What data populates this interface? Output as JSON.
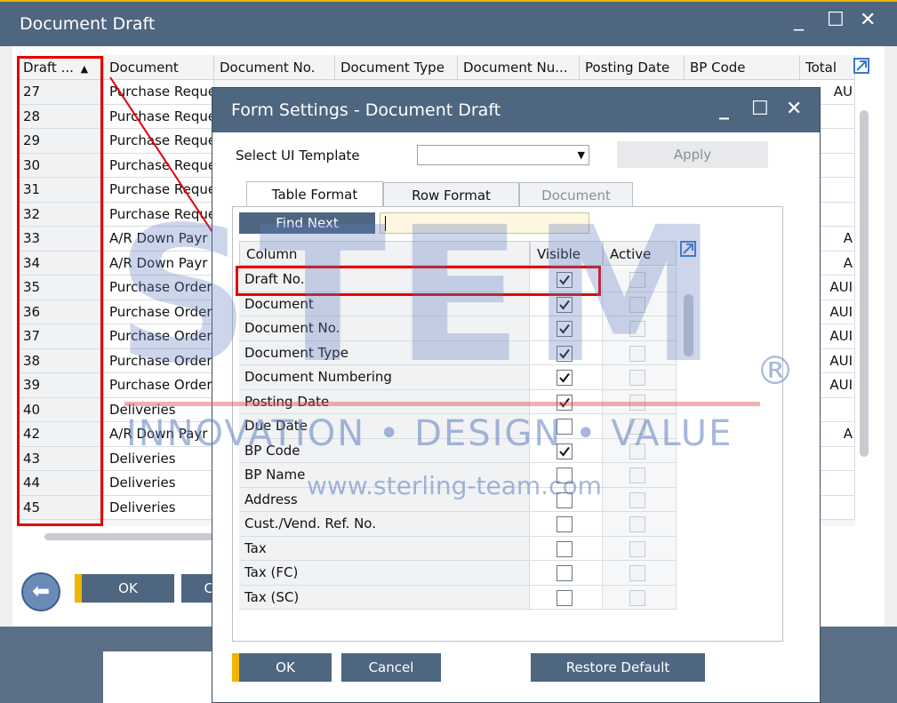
{
  "main_window": {
    "title": "Document Draft",
    "controls": {
      "minimize": "_",
      "maximize": "☐",
      "close": "✕"
    },
    "columns": [
      "Draft ...",
      "Document",
      "Document No.",
      "Document Type",
      "Document Nu...",
      "Posting Date",
      "BP Code",
      "Total"
    ],
    "sort_indicator": "▲",
    "rows": [
      {
        "draft": "27",
        "document": "Purchase Reque",
        "currency": "AU"
      },
      {
        "draft": "28",
        "document": "Purchase Reque",
        "currency": ""
      },
      {
        "draft": "29",
        "document": "Purchase Reque",
        "currency": ""
      },
      {
        "draft": "30",
        "document": "Purchase Reque",
        "currency": ""
      },
      {
        "draft": "31",
        "document": "Purchase Reque",
        "currency": ""
      },
      {
        "draft": "32",
        "document": "Purchase Reque",
        "currency": ""
      },
      {
        "draft": "33",
        "document": "A/R Down Payr",
        "currency": "A"
      },
      {
        "draft": "34",
        "document": "A/R Down Payr",
        "currency": "A"
      },
      {
        "draft": "35",
        "document": "Purchase Order",
        "currency": "AUI"
      },
      {
        "draft": "36",
        "document": "Purchase Order",
        "currency": "AUI"
      },
      {
        "draft": "37",
        "document": "Purchase Order",
        "currency": "AUI"
      },
      {
        "draft": "38",
        "document": "Purchase Order",
        "currency": "AUI"
      },
      {
        "draft": "39",
        "document": "Purchase Order",
        "currency": "AUI"
      },
      {
        "draft": "40",
        "document": "Deliveries",
        "currency": ""
      },
      {
        "draft": "42",
        "document": "A/R Down Payr",
        "currency": "A"
      },
      {
        "draft": "43",
        "document": "Deliveries",
        "currency": ""
      },
      {
        "draft": "44",
        "document": "Deliveries",
        "currency": ""
      },
      {
        "draft": "45",
        "document": "Deliveries",
        "currency": ""
      }
    ],
    "ok_label": "OK",
    "cancel_label_partial": "C"
  },
  "dialog": {
    "title": "Form Settings - Document Draft",
    "controls": {
      "minimize": "_",
      "maximize": "☐",
      "close": "✕"
    },
    "ui_template_label": "Select UI Template",
    "ui_template_value": "",
    "apply_label": "Apply",
    "tabs": [
      {
        "label": "Table Format",
        "state": "active"
      },
      {
        "label": "Row Format",
        "state": "normal"
      },
      {
        "label": "Document",
        "state": "disabled"
      }
    ],
    "find_next_label": "Find Next",
    "find_value": "",
    "headers": {
      "column": "Column",
      "visible": "Visible",
      "active": "Active"
    },
    "rows": [
      {
        "name": "Draft No.",
        "visible": true,
        "active": false
      },
      {
        "name": "Document",
        "visible": true,
        "active": false
      },
      {
        "name": "Document No.",
        "visible": true,
        "active": false
      },
      {
        "name": "Document Type",
        "visible": true,
        "active": false
      },
      {
        "name": "Document Numbering",
        "visible": true,
        "active": false
      },
      {
        "name": "Posting Date",
        "visible": true,
        "active": false
      },
      {
        "name": "Due Date",
        "visible": false,
        "active": false
      },
      {
        "name": "BP Code",
        "visible": true,
        "active": false
      },
      {
        "name": "BP Name",
        "visible": false,
        "active": false
      },
      {
        "name": "Address",
        "visible": false,
        "active": false
      },
      {
        "name": "Cust./Vend. Ref. No.",
        "visible": false,
        "active": false
      },
      {
        "name": "Tax",
        "visible": false,
        "active": false
      },
      {
        "name": "Tax (FC)",
        "visible": false,
        "active": false
      },
      {
        "name": "Tax (SC)",
        "visible": false,
        "active": false
      }
    ],
    "ok_label": "OK",
    "cancel_label": "Cancel",
    "restore_label": "Restore Default"
  },
  "watermark": {
    "brand": "STEM",
    "registered": "®",
    "tagline": "INNOVATION • DESIGN • VALUE",
    "url": "www.sterling-team.com"
  },
  "colors": {
    "titlebar": "#4e6680",
    "accent": "#f0b400",
    "highlight": "#e30000",
    "find_input": "#fdf7e1"
  }
}
